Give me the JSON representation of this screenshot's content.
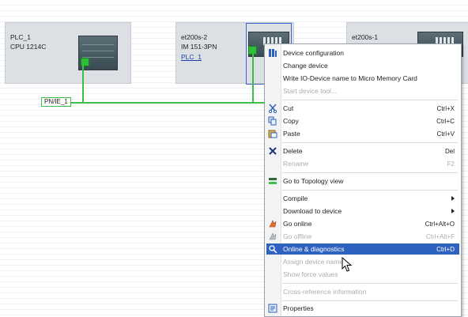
{
  "devices": [
    {
      "name": "PLC_1",
      "type": "CPU 1214C"
    },
    {
      "name": "et200s-2",
      "type": "IM 151-3PN",
      "link": "PLC_1"
    },
    {
      "name": "et200s-1"
    }
  ],
  "network_label": "PN/IE_1",
  "context_menu": {
    "items": [
      {
        "label": "Device configuration",
        "icon": "device-config-icon",
        "enabled": true
      },
      {
        "label": "Change device",
        "enabled": true
      },
      {
        "label": "Write IO-Device name to Micro Memory Card",
        "enabled": true
      },
      {
        "label": "Start device tool...",
        "enabled": false
      },
      {
        "label": "Cut",
        "shortcut": "Ctrl+X",
        "icon": "cut-icon",
        "enabled": true
      },
      {
        "label": "Copy",
        "shortcut": "Ctrl+C",
        "icon": "copy-icon",
        "enabled": true
      },
      {
        "label": "Paste",
        "shortcut": "Ctrl+V",
        "icon": "paste-icon",
        "enabled": true
      },
      {
        "label": "Delete",
        "shortcut": "Del",
        "icon": "delete-icon",
        "enabled": true
      },
      {
        "label": "Rename",
        "shortcut": "F2",
        "enabled": false
      },
      {
        "label": "Go to Topology view",
        "icon": "topology-icon",
        "enabled": true
      },
      {
        "label": "Compile",
        "submenu": true,
        "enabled": true
      },
      {
        "label": "Download to device",
        "submenu": true,
        "enabled": true
      },
      {
        "label": "Go online",
        "shortcut": "Ctrl+Alt+O",
        "icon": "go-online-icon",
        "enabled": true
      },
      {
        "label": "Go offline",
        "shortcut": "Ctrl+Alt+F",
        "icon": "go-offline-icon",
        "enabled": false
      },
      {
        "label": "Online & diagnostics",
        "shortcut": "Ctrl+D",
        "icon": "diagnostics-icon",
        "enabled": true,
        "highlighted": true
      },
      {
        "label": "Assign device name",
        "enabled": false
      },
      {
        "label": "Show force values",
        "enabled": false
      },
      {
        "label": "Cross-reference information",
        "enabled": false
      },
      {
        "label": "Properties",
        "icon": "properties-icon",
        "enabled": true
      }
    ]
  },
  "colors": {
    "network": "#3fbf4a",
    "highlight": "#2f62c0",
    "device_bg": "#dcdfe4"
  }
}
